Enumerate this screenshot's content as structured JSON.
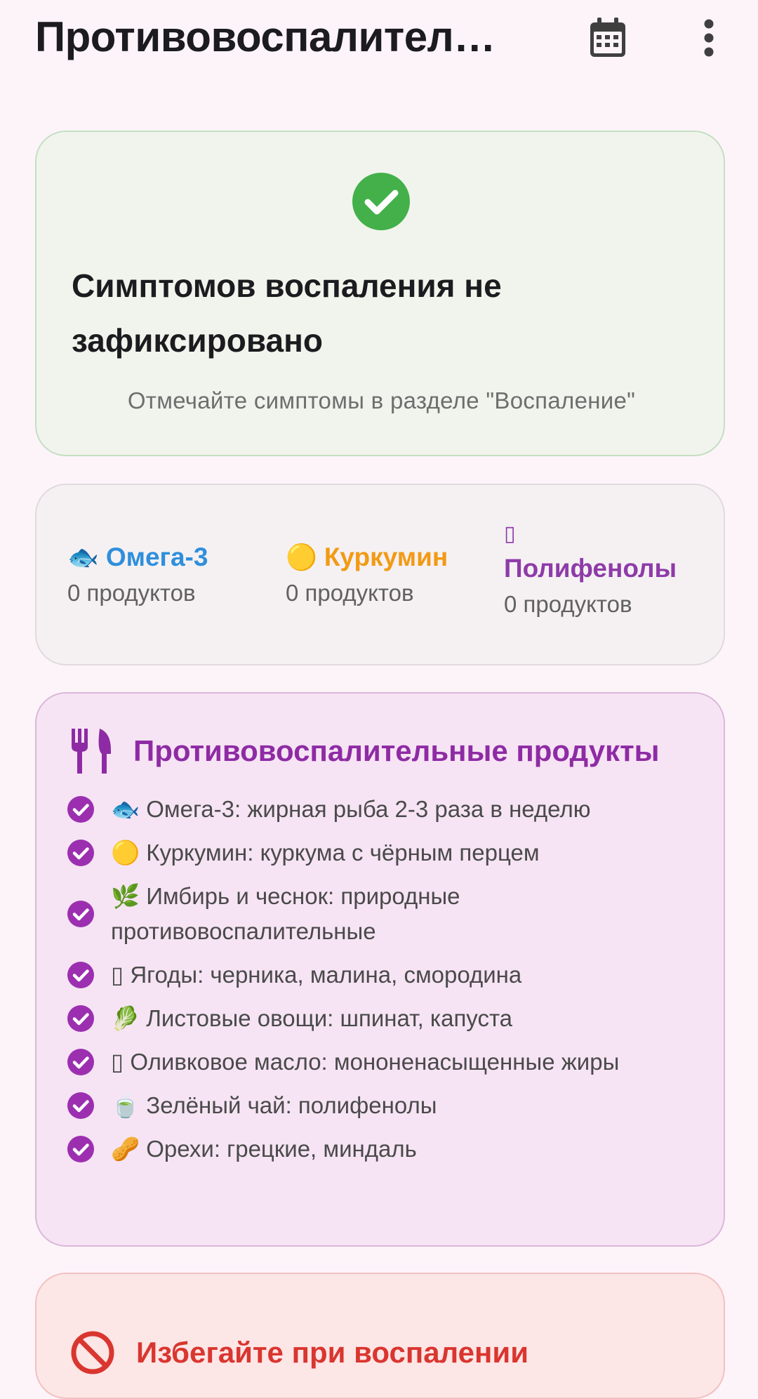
{
  "appbar": {
    "title": "Противовоспалител…",
    "calendar_icon": "calendar-icon",
    "more_icon": "more-vert-icon"
  },
  "status": {
    "icon": "check-circle-icon",
    "title": "Симптомов воспаления не зафиксировано",
    "subtitle": "Отмечайте симптомы в разделе \"Воспаление\""
  },
  "stats": [
    {
      "emoji": "🐟",
      "name": "Омега-3",
      "count": "0 продуктов",
      "color": "#2f8fdc"
    },
    {
      "emoji": "🟡",
      "name": "Куркумин",
      "count": "0 продуктов",
      "color": "#f29a14"
    },
    {
      "emoji": "▯",
      "name": "Полифенолы",
      "count": "0 продуктов",
      "color": "#8e3ba8"
    }
  ],
  "foods": {
    "icon": "fork-knife-icon",
    "title": "Противовоспалительные продукты",
    "items": [
      "🐟 Омега-3: жирная рыба 2-3 раза в неделю",
      "🟡 Куркумин: куркума с чёрным перцем",
      "🌿 Имбирь и чеснок: природные противовоспалительные",
      "▯ Ягоды: черника, малина, смородина",
      "🥬 Листовые овощи: шпинат, капуста",
      "▯ Оливковое масло: мононенасыщенные жиры",
      "🍵 Зелёный чай: полифенолы",
      "🥜 Орехи: грецкие, миндаль"
    ]
  },
  "avoid": {
    "icon": "ban-icon",
    "title": "Избегайте при воспалении"
  },
  "colors": {
    "accent_purple": "#8e2ba4",
    "success_green": "#43b04a",
    "danger_red": "#d9362f"
  }
}
